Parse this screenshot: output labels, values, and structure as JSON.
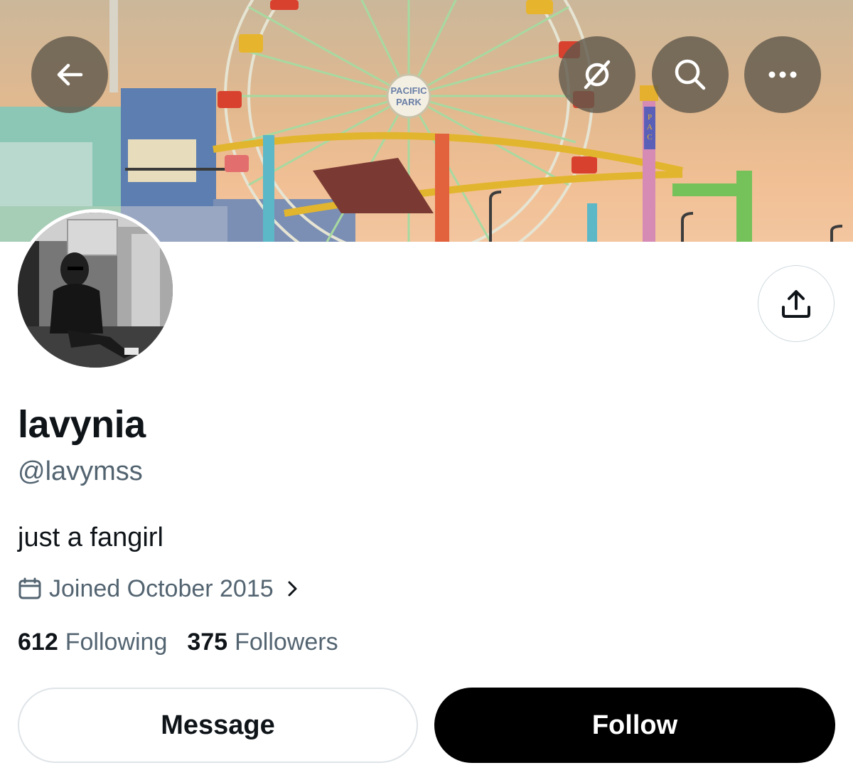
{
  "header": {
    "back_icon": "arrow-left-icon",
    "grok_icon": "slashed-circle-icon",
    "search_icon": "search-icon",
    "more_icon": "ellipsis-icon",
    "banner_sign": "PACIFIC PARK",
    "banner_vertical_sign": "PAC"
  },
  "profile": {
    "display_name": "lavynia",
    "handle": "@lavymss",
    "bio": "just a fangirl",
    "joined": "Joined October 2015",
    "following_count": "612",
    "following_label": "Following",
    "followers_count": "375",
    "followers_label": "Followers"
  },
  "actions": {
    "share_icon": "share-upload-icon",
    "message_label": "Message",
    "follow_label": "Follow"
  },
  "colors": {
    "primary_text": "#0f1419",
    "secondary_text": "#536471",
    "follow_bg": "#000000",
    "border": "#cfd9de"
  }
}
